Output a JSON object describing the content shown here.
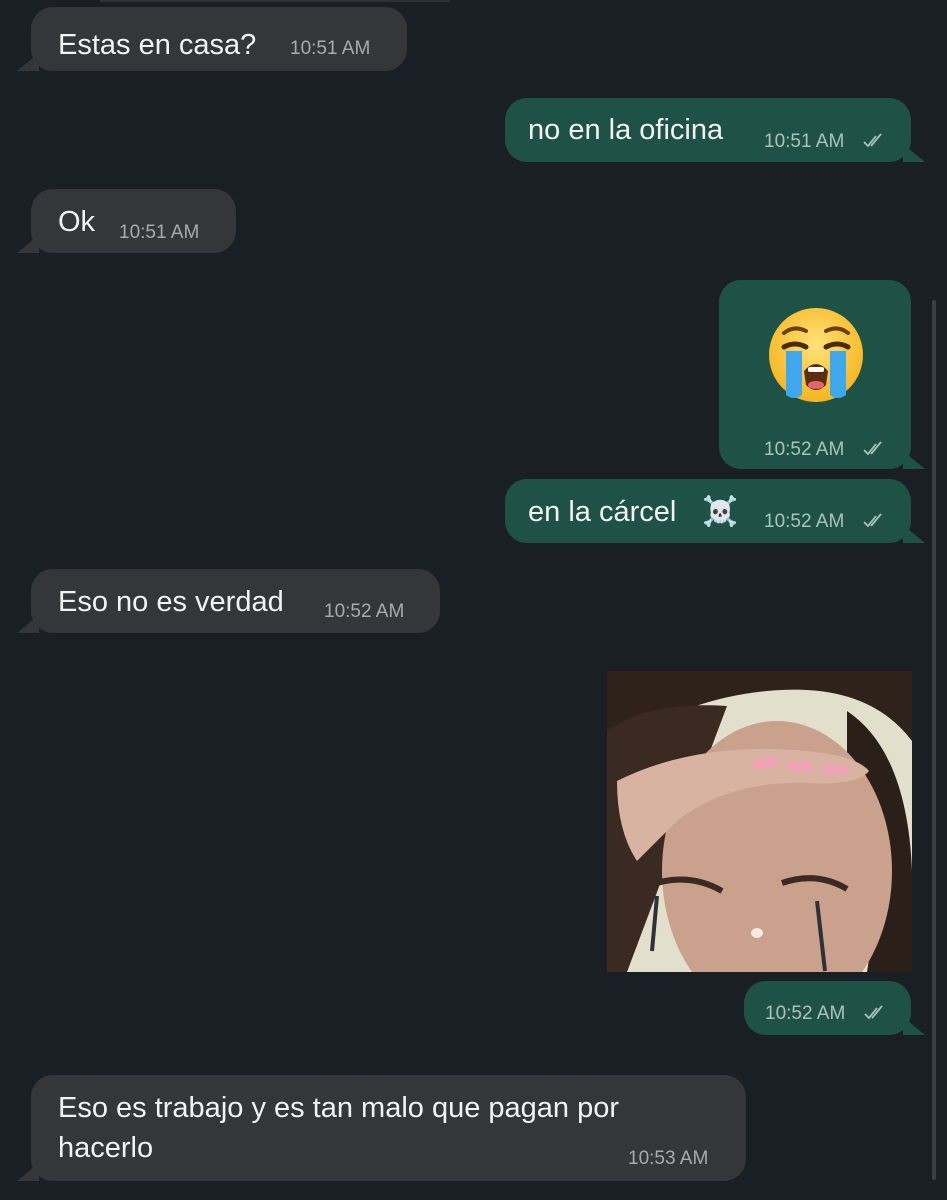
{
  "messages": [
    {
      "direction": "incoming",
      "text": "Estas en casa?",
      "time": "10:51 AM"
    },
    {
      "direction": "outgoing",
      "text": "no en la oficina",
      "time": "10:51 AM",
      "status": "read-double-check-icon"
    },
    {
      "direction": "incoming",
      "text": "Ok",
      "time": "10:51 AM"
    },
    {
      "direction": "outgoing",
      "type": "emoji",
      "emoji": "loudly-crying-face",
      "time": "10:52 AM",
      "status": "read-double-check-icon"
    },
    {
      "direction": "outgoing",
      "text": "en la cárcel",
      "emoji_suffix": "☠️",
      "time": "10:52 AM",
      "status": "read-double-check-icon"
    },
    {
      "direction": "incoming",
      "text": "Eso no es verdad",
      "time": "10:52 AM"
    },
    {
      "direction": "outgoing",
      "type": "image",
      "image": "crying-woman-photo",
      "time": "10:52 AM",
      "status": "read-double-check-icon"
    },
    {
      "direction": "incoming",
      "text": "Eso es trabajo y es tan malo que pagan por",
      "text_line2": "hacerlo",
      "time": "10:53 AM"
    }
  ],
  "colors": {
    "background": "#1a1f26",
    "incoming_bubble": "#35363a",
    "outgoing_bubble": "#1f5246",
    "timestamp": "#a6abb0"
  }
}
